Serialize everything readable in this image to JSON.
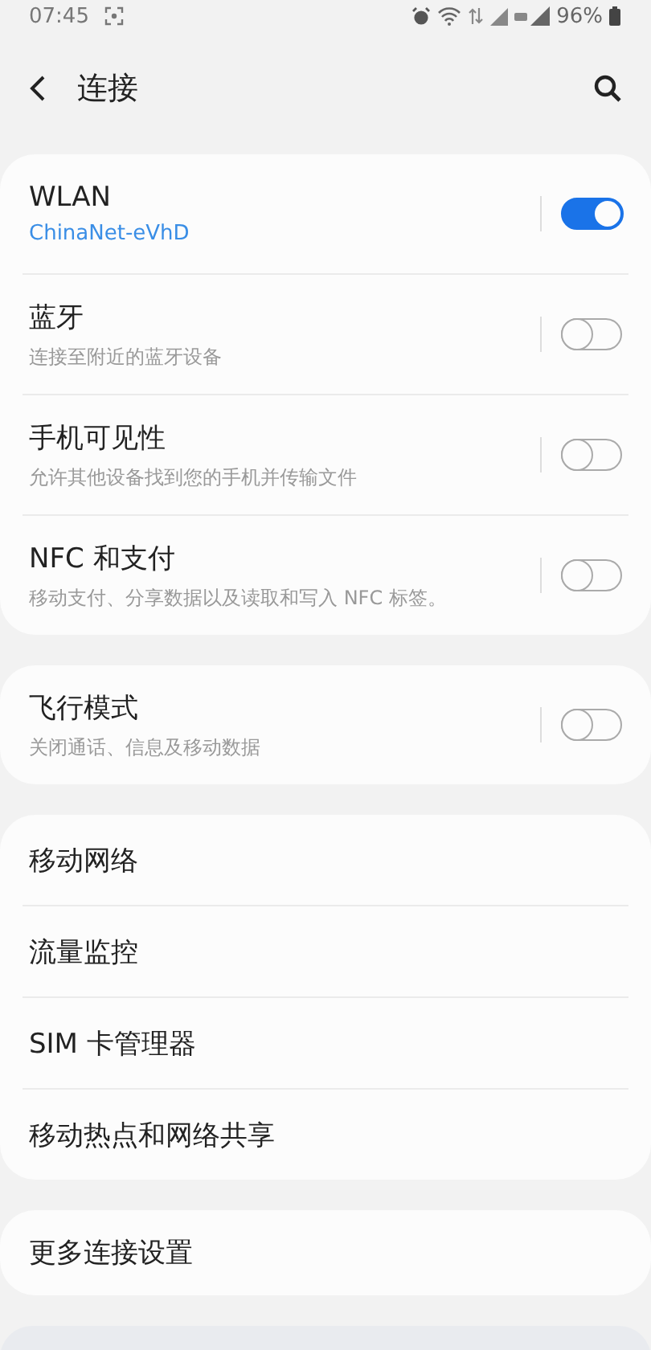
{
  "status_bar": {
    "time": "07:45",
    "battery": "96%"
  },
  "header": {
    "title": "连接"
  },
  "groups": [
    {
      "items": [
        {
          "kind": "switch",
          "title": "WLAN",
          "subtitle": "ChinaNet-eVhD",
          "subtitle_highlighted": true,
          "on": true
        },
        {
          "kind": "switch",
          "title": "蓝牙",
          "subtitle": "连接至附近的蓝牙设备",
          "subtitle_highlighted": false,
          "on": false
        },
        {
          "kind": "switch",
          "title": "手机可见性",
          "subtitle": "允许其他设备找到您的手机并传输文件",
          "subtitle_highlighted": false,
          "on": false
        },
        {
          "kind": "switch",
          "title": "NFC 和支付",
          "subtitle": "移动支付、分享数据以及读取和写入 NFC 标签。",
          "subtitle_highlighted": false,
          "on": false
        }
      ]
    },
    {
      "items": [
        {
          "kind": "switch",
          "title": "飞行模式",
          "subtitle": "关闭通话、信息及移动数据",
          "subtitle_highlighted": false,
          "on": false
        }
      ]
    },
    {
      "items": [
        {
          "kind": "link",
          "title": "移动网络"
        },
        {
          "kind": "link",
          "title": "流量监控"
        },
        {
          "kind": "link",
          "title": "SIM 卡管理器"
        },
        {
          "kind": "link",
          "title": "移动热点和网络共享"
        }
      ]
    },
    {
      "items": [
        {
          "kind": "link",
          "title": "更多连接设置"
        }
      ]
    }
  ]
}
